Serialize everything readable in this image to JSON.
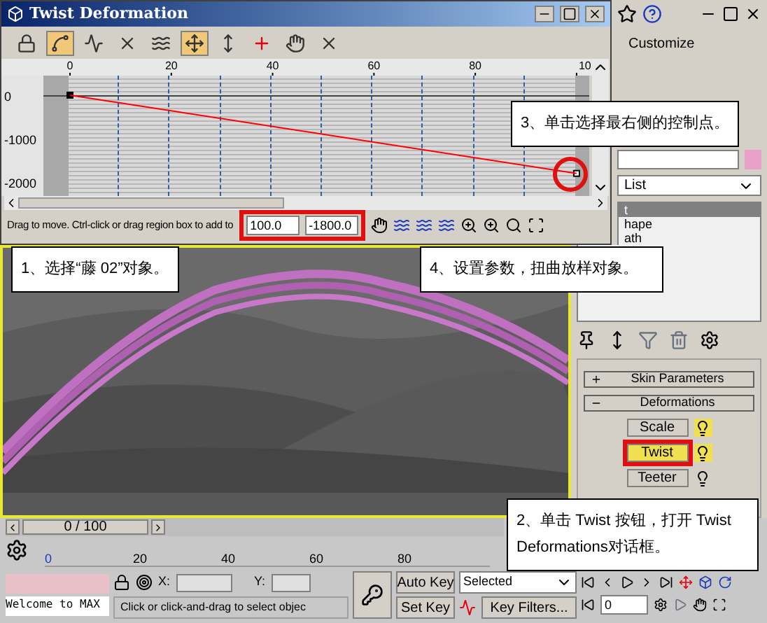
{
  "dialog": {
    "title": "Twist Deformation",
    "tools": [
      {
        "kind": "lock",
        "selected": false
      },
      {
        "kind": "curve",
        "selected": true
      },
      {
        "kind": "line",
        "selected": false
      },
      {
        "kind": "cross",
        "selected": false
      },
      {
        "kind": "wave",
        "selected": false
      },
      {
        "kind": "move",
        "selected": true
      },
      {
        "kind": "scale",
        "selected": false
      },
      {
        "kind": "insert",
        "selected": false
      },
      {
        "kind": "hand",
        "selected": false
      },
      {
        "kind": "delete",
        "selected": false
      }
    ],
    "chart_data": {
      "type": "line",
      "x": [
        0,
        100
      ],
      "series": [
        {
          "color": "#ff0000",
          "marker": "square",
          "values": [
            0,
            -1800
          ]
        }
      ],
      "xlim": [
        -5.25,
        102.5
      ],
      "ylim": [
        -2320,
        450
      ],
      "xticks": [
        0,
        20,
        40,
        60,
        80
      ],
      "yticks": [
        0,
        -1000,
        -2000
      ]
    },
    "ruler_edge_label": "10",
    "status": "Drag to move. Ctrl-click or drag region box to add to",
    "x_value": "100.0",
    "y_value": "-1800.0"
  },
  "command_panel": {
    "menu": "Customize",
    "dropdown": "List",
    "stack": [
      {
        "label": "t",
        "selected": true
      },
      {
        "label": "hape",
        "selected": false
      },
      {
        "label": "ath",
        "selected": false
      }
    ],
    "rollouts": [
      {
        "label": "Skin Parameters",
        "expanded": false
      },
      {
        "label": "Deformations",
        "expanded": true
      }
    ],
    "deformations": [
      {
        "label": "Scale",
        "selected": false,
        "on": true
      },
      {
        "label": "Twist",
        "selected": true,
        "on": true
      },
      {
        "label": "Teeter",
        "selected": false,
        "on": false
      }
    ]
  },
  "callouts": [
    "3、单击选择最右侧的控制点。",
    "1、选择“藤 02”对象。",
    "4、设置参数，扭曲放样对象。",
    "2、单击 Twist 按钮，打开 Twist Deformations对话框。"
  ],
  "timeline": {
    "frame": "0 / 100",
    "level": 0,
    "ticks": [
      "0",
      "20",
      "40",
      "60",
      "80"
    ]
  },
  "status_bar": {
    "message": "Welcome to MAX",
    "prompt": "Click or click-and-drag to select objec",
    "x_label": "X:",
    "y_label": "Y:",
    "auto_key": "Auto Key",
    "set_key": "Set Key",
    "selection": "Selected",
    "key_filters": "Key Filters...",
    "frame": "0"
  }
}
